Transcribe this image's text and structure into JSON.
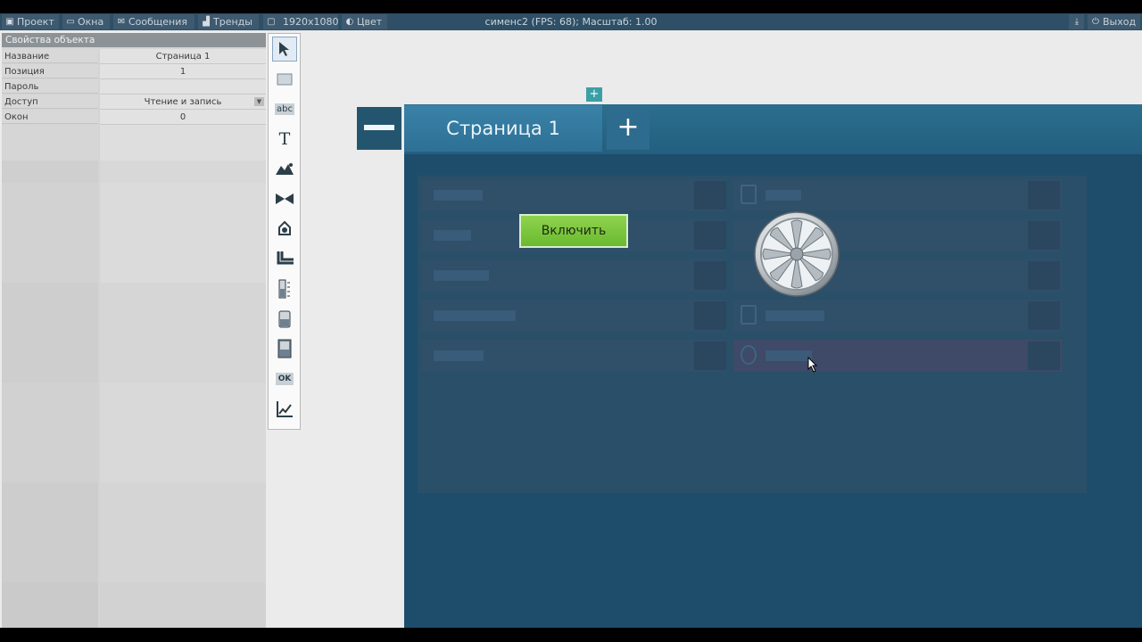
{
  "menubar": {
    "items": [
      {
        "label": "Проект",
        "icon": "project-icon"
      },
      {
        "label": "Окна",
        "icon": "windows-icon"
      },
      {
        "label": "Сообщения",
        "icon": "messages-icon"
      },
      {
        "label": "Тренды",
        "icon": "trends-icon"
      },
      {
        "label": "1920x1080",
        "icon": "resolution-icon"
      },
      {
        "label": "Цвет",
        "icon": "color-icon"
      }
    ],
    "status": "сименс2  (FPS: 68); Масштаб: 1.00",
    "download_icon": "download-icon",
    "exit_label": "Выход"
  },
  "properties": {
    "title": "Свойства объекта",
    "rows": [
      {
        "name": "Название",
        "value": "Страница 1"
      },
      {
        "name": "Позиция",
        "value": "1"
      },
      {
        "name": "Пароль",
        "value": ""
      },
      {
        "name": "Доступ",
        "value": "Чтение и запись"
      },
      {
        "name": "Окон",
        "value": "0"
      }
    ]
  },
  "toolbar": {
    "tools": [
      "pointer-icon",
      "rectangle-icon",
      "label-abc-icon",
      "text-icon",
      "image-icon",
      "valve-icon",
      "pump-icon",
      "pipe-icon",
      "gauge-icon",
      "tank-icon",
      "panel-icon",
      "ok-button-icon",
      "trend-chart-icon"
    ],
    "abc": "abc",
    "t": "T",
    "ok": "OK"
  },
  "hmi": {
    "tab_label": "Страница 1",
    "plus": "+",
    "small_plus": "+",
    "button_label": "Включить"
  },
  "colors": {
    "hmi_bg": "#1d4d6b",
    "tab": "#3a82a8",
    "button_green": "#7cc63c",
    "menubar": "#2e4f66"
  }
}
